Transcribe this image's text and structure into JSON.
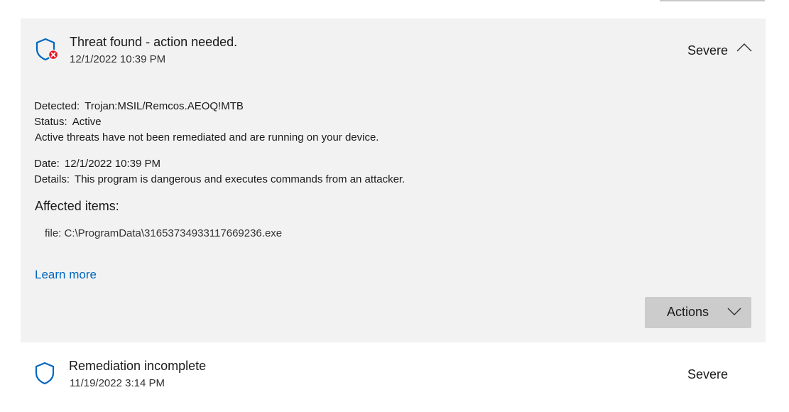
{
  "threat1": {
    "title": "Threat found - action needed.",
    "date": "12/1/2022 10:39 PM",
    "severity": "Severe",
    "icon": "shield-error-icon",
    "detected_label": "Detected:",
    "detected_value": "Trojan:MSIL/Remcos.AEOQ!MTB",
    "status_label": "Status:",
    "status_value": "Active",
    "status_note": "Active threats have not been remediated and are running on your device.",
    "date_label": "Date:",
    "date_value": "12/1/2022 10:39 PM",
    "details_label": "Details:",
    "details_value": "This program is dangerous and executes commands from an attacker.",
    "affected_heading": "Affected items:",
    "affected_items": [
      "file: C:\\ProgramData\\31653734933117669236.exe"
    ],
    "learn_more": "Learn more",
    "actions_label": "Actions"
  },
  "threat2": {
    "title": "Remediation incomplete",
    "date": "11/19/2022 3:14 PM",
    "severity": "Severe",
    "icon": "shield-icon"
  },
  "colors": {
    "accent": "#0067c0",
    "error": "#e81123",
    "card_bg": "#f2f2f2",
    "button_bg": "#cccccc"
  }
}
